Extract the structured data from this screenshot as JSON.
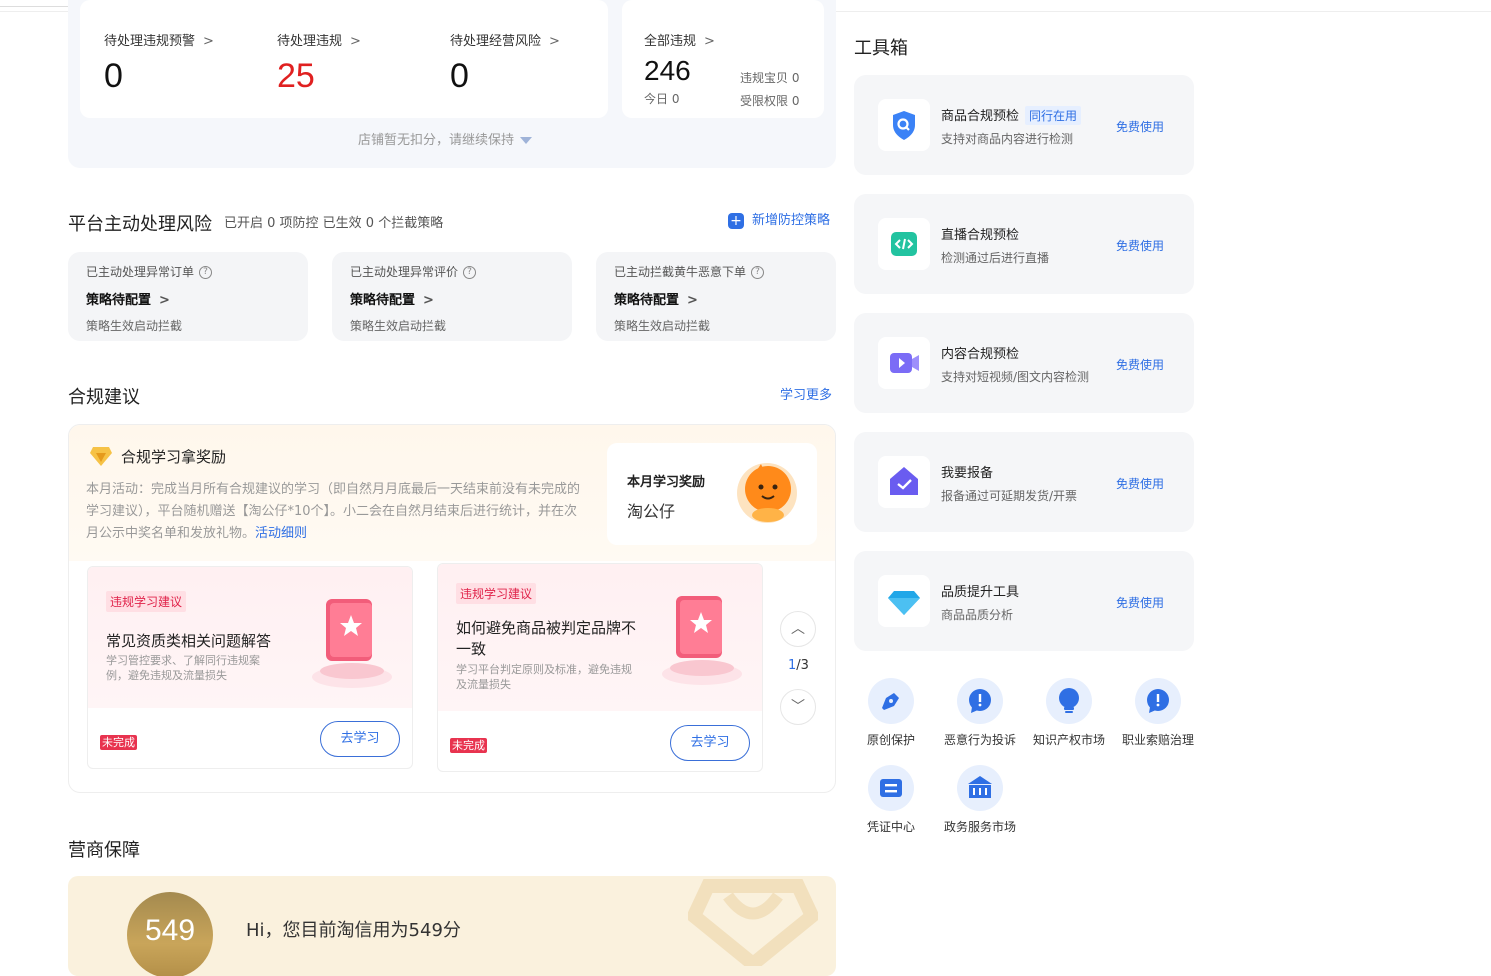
{
  "violations": {
    "stats": [
      {
        "label": "待处理违规预警",
        "value": "0"
      },
      {
        "label": "待处理违规",
        "value": "25"
      },
      {
        "label": "待处理经营风险",
        "value": "0"
      }
    ],
    "total": {
      "label": "全部违规",
      "value": "246",
      "today": "今日 0",
      "copy_label": "违规宝贝 0",
      "restrict_label": "受限权限 0"
    },
    "hint": "店铺暂无扣分，请继续保持"
  },
  "platform_risk": {
    "title": "平台主动处理风险",
    "subtitle": "已开启 0 项防控 已生效 0 个拦截策略",
    "add_link": "新增防控策略",
    "cards": [
      {
        "label": "已主动处理异常订单",
        "status": "策略待配置",
        "sub": "策略生效启动拦截"
      },
      {
        "label": "已主动处理异常评价",
        "status": "策略待配置",
        "sub": "策略生效启动拦截"
      },
      {
        "label": "已主动拦截黄牛恶意下单",
        "status": "策略待配置",
        "sub": "策略生效启动拦截"
      }
    ]
  },
  "compliance": {
    "title": "合规建议",
    "more_link": "学习更多",
    "reward_title": "合规学习拿奖励",
    "reward_desc": "本月活动：完成当月所有合规建议的学习（即自然月月底最后一天结束前没有未完成的学习建议），平台随机赠送【淘公仔*10个】。小二会在自然月结束后进行统计，并在次月公示中奖名单和发放礼物。",
    "reward_link": "活动细则",
    "prize_label": "本月学习奖励",
    "prize_name": "淘公仔",
    "cards": [
      {
        "tag": "违规学习建议",
        "title": "常见资质类相关问题解答",
        "sub": "学习管控要求、了解同行违规案例，避免违规及流量损失",
        "status": "未完成",
        "button": "去学习"
      },
      {
        "tag": "违规学习建议",
        "title": "如何避免商品被判定品牌不一致",
        "sub": "学习平台判定原则及标准，避免违规及流量损失",
        "status": "未完成",
        "button": "去学习"
      }
    ],
    "pager_current": "1",
    "pager_total": "/3"
  },
  "guarantee": {
    "title": "营商保障",
    "score": "549",
    "message": "Hi，您目前淘信用为549分"
  },
  "toolbox": {
    "title": "工具箱",
    "tools": [
      {
        "title": "商品合规预检",
        "tag": "同行在用",
        "sub": "支持对商品内容进行检测",
        "action": "免费使用",
        "icon": "shield-search-icon",
        "color": "#3b82f6"
      },
      {
        "title": "直播合规预检",
        "tag": "",
        "sub": "检测通过后进行直播",
        "action": "免费使用",
        "icon": "code-icon",
        "color": "#22c3a0"
      },
      {
        "title": "内容合规预检",
        "tag": "",
        "sub": "支持对短视频/图文内容检测",
        "action": "免费使用",
        "icon": "video-icon",
        "color": "#7b6cf6"
      },
      {
        "title": "我要报备",
        "tag": "",
        "sub": "报备通过可延期发货/开票",
        "action": "免费使用",
        "icon": "house-check-icon",
        "color": "#6a5cf0"
      },
      {
        "title": "品质提升工具",
        "tag": "",
        "sub": "商品品质分析",
        "action": "免费使用",
        "icon": "diamond-icon",
        "color": "#21a7e8"
      }
    ],
    "quick": [
      {
        "label": "原创保护",
        "icon": "pen-icon"
      },
      {
        "label": "恶意行为投诉",
        "icon": "alert-icon"
      },
      {
        "label": "知识产权市场",
        "icon": "bulb-icon"
      },
      {
        "label": "职业索赔治理",
        "icon": "alert-icon"
      },
      {
        "label": "凭证中心",
        "icon": "ticket-icon"
      },
      {
        "label": "政务服务市场",
        "icon": "bank-icon"
      }
    ]
  }
}
